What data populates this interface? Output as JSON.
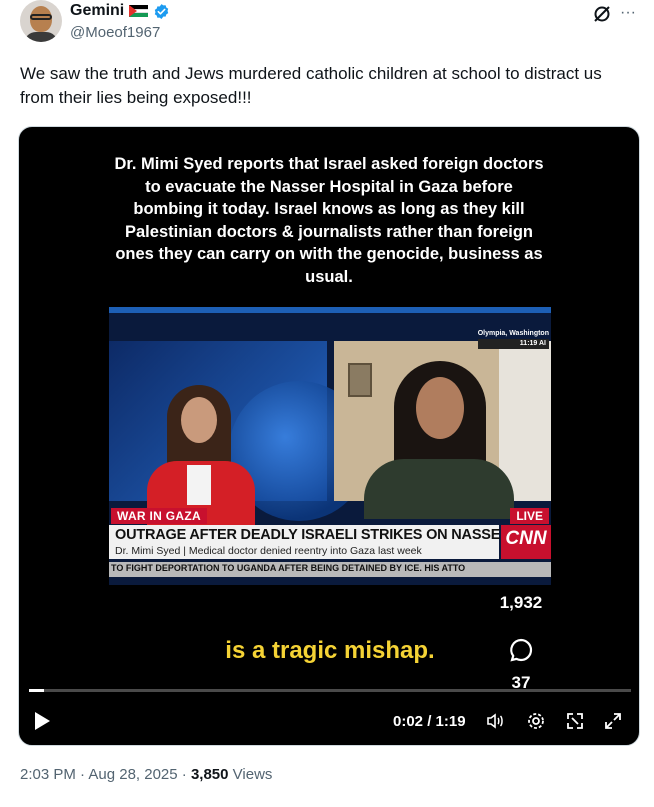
{
  "author": {
    "display_name": "Gemini",
    "handle": "@Moeof1967",
    "flag_icon": "palestine-flag-icon",
    "verified_color": "#1d9bf0"
  },
  "header_actions": {
    "grok_icon": "slashed-circle-icon",
    "more_label": "···"
  },
  "tweet": {
    "text": "We saw the truth and Jews murdered catholic children at school to distract us from their lies being exposed!!!"
  },
  "video": {
    "overlay_text": "Dr. Mimi Syed reports that Israel asked foreign doctors to evacuate the Nasser Hospital in Gaza before bombing it today. Israel knows as long as they kill Palestinian doctors & journalists rather than foreign ones they can carry on with the genocide, business as usual.",
    "broadcast": {
      "location": "Olympia, Washington",
      "time": "11:19 AI",
      "section_label": "WAR IN GAZA",
      "live_label": "LIVE",
      "headline": "OUTRAGE AFTER DEADLY ISRAELI STRIKES ON NASSER HOSPITAL",
      "subhead": "Dr. Mimi Syed  |  Medical doctor denied reentry into Gaza last week",
      "network": "CNN",
      "ticker": "TO FIGHT DEPORTATION TO UGANDA AFTER BEING DETAINED BY ICE. HIS ATTO"
    },
    "side_stats": {
      "likes": "1,932",
      "comments": "37"
    },
    "subtitle": "is a tragic mishap.",
    "controls": {
      "time_display": "0:02 / 1:19",
      "progress_fraction": 0.025
    }
  },
  "footer": {
    "timestamp": "2:03 PM · Aug 28, 2025 · ",
    "views_count": "3,850",
    "views_label": " Views"
  }
}
